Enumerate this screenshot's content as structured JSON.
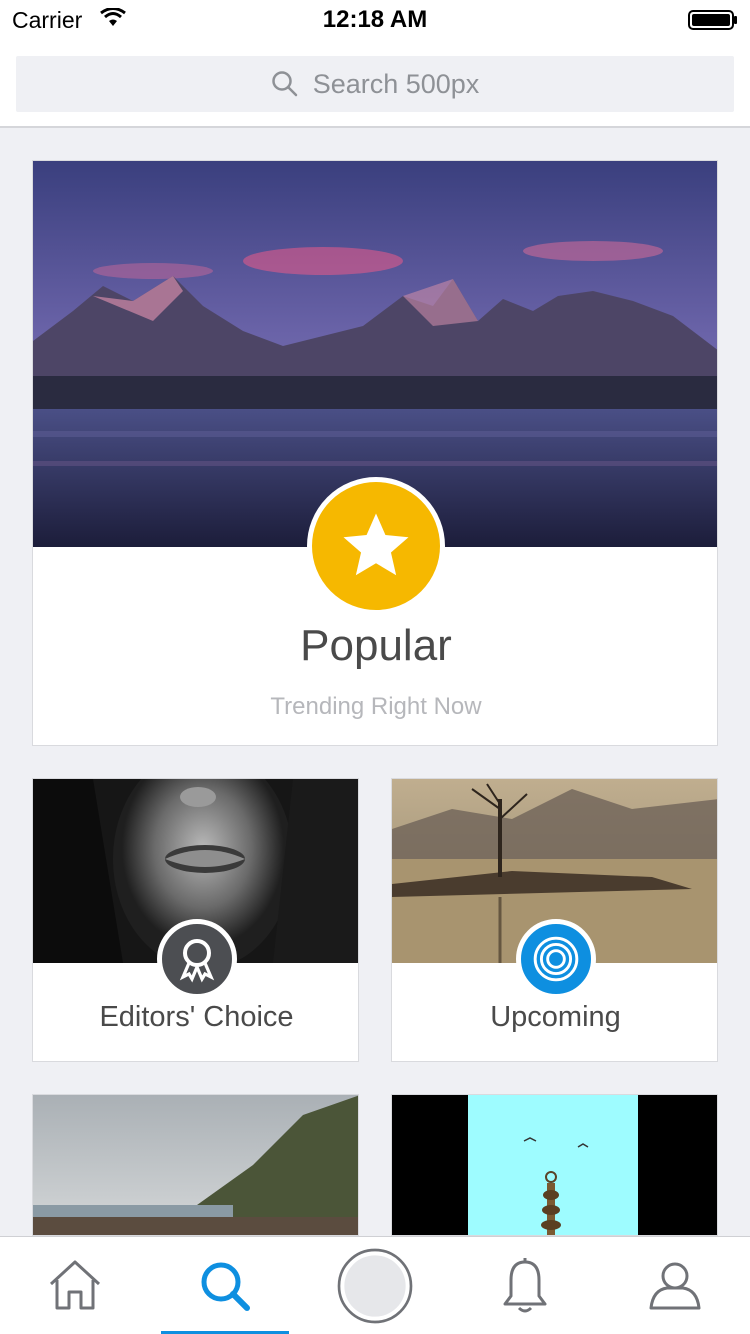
{
  "status_bar": {
    "carrier": "Carrier",
    "time": "12:18 AM"
  },
  "search": {
    "placeholder": "Search 500px"
  },
  "categories": {
    "popular": {
      "title": "Popular",
      "subtitle": "Trending Right Now"
    },
    "editors_choice": {
      "title": "Editors' Choice"
    },
    "upcoming": {
      "title": "Upcoming"
    }
  },
  "tabbar": {
    "items": [
      "home-icon",
      "search-icon",
      "camera-icon",
      "bell-icon",
      "profile-icon"
    ],
    "active": "search-icon"
  },
  "colors": {
    "accent": "#0e8fe0",
    "popular_badge": "#f6b800",
    "editors_badge": "#4c4e52"
  }
}
